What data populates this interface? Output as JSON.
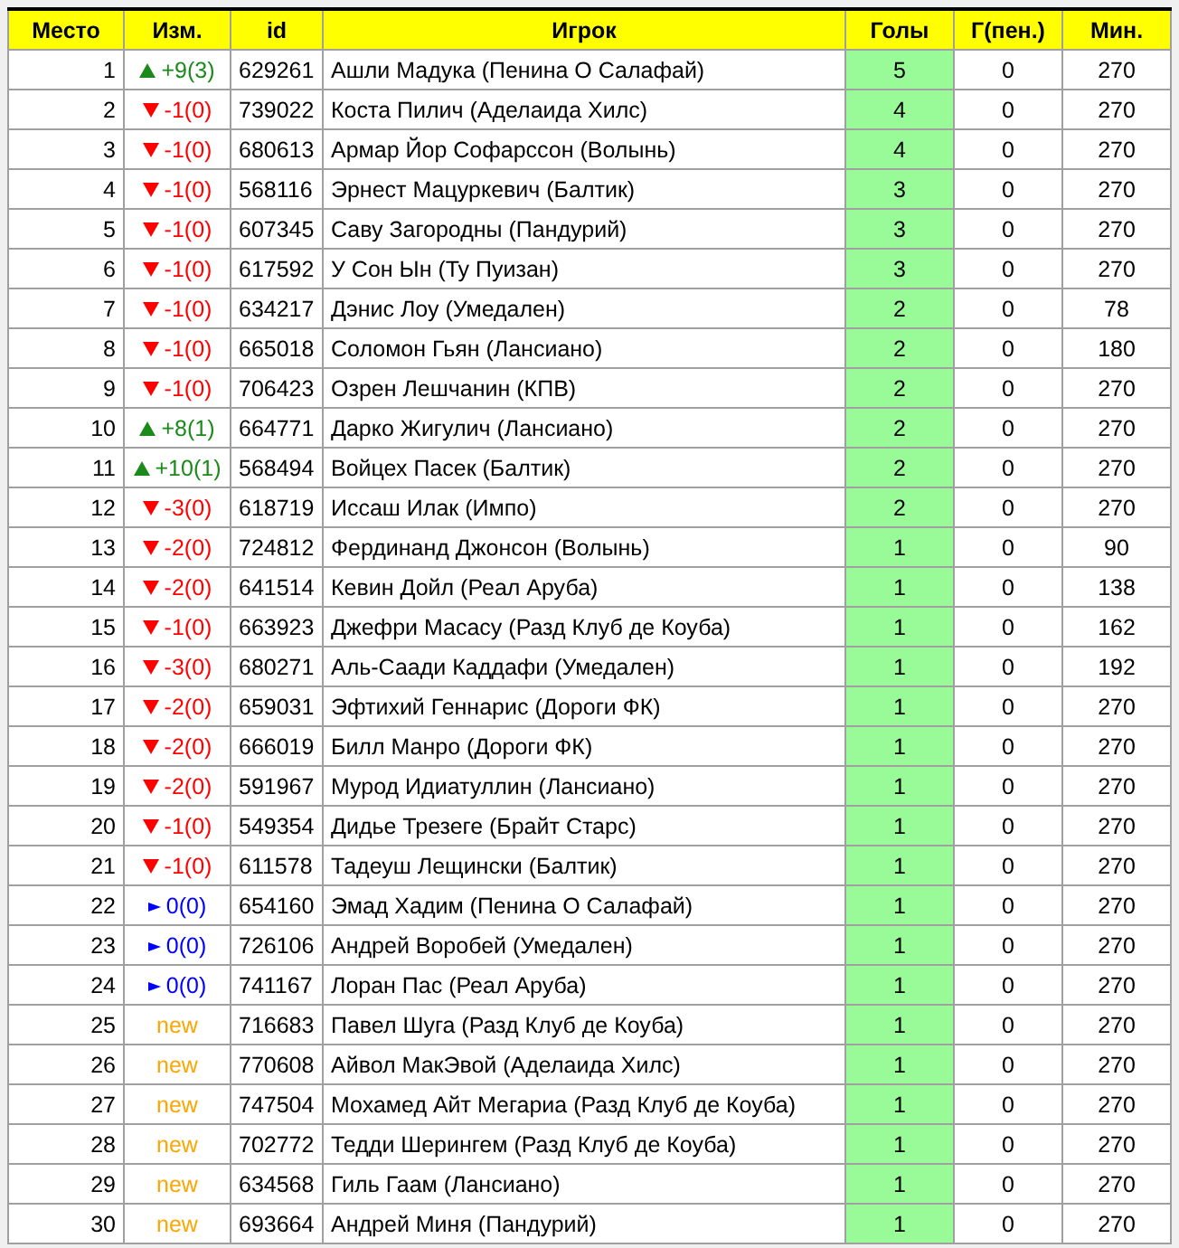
{
  "table": {
    "columns": [
      {
        "label": "Место",
        "sorted": false
      },
      {
        "label": "Изм.",
        "sorted": false
      },
      {
        "label": "id",
        "sorted": false
      },
      {
        "label": "Игрок",
        "sorted": false
      },
      {
        "label": "Голы",
        "sorted": true
      },
      {
        "label": "Г(пен.)",
        "sorted": false
      },
      {
        "label": "Мин.",
        "sorted": false
      }
    ],
    "rows": [
      {
        "place": "1",
        "change": {
          "kind": "up",
          "text": "+9(3)"
        },
        "id": "629261",
        "player": "Ашли Мадука (Пенина О Салафай)",
        "goals": "5",
        "pen": "0",
        "min": "270"
      },
      {
        "place": "2",
        "change": {
          "kind": "down",
          "text": "-1(0)"
        },
        "id": "739022",
        "player": "Коста Пилич (Аделаида Хилс)",
        "goals": "4",
        "pen": "0",
        "min": "270"
      },
      {
        "place": "3",
        "change": {
          "kind": "down",
          "text": "-1(0)"
        },
        "id": "680613",
        "player": "Армар Йор Софарссон (Волынь)",
        "goals": "4",
        "pen": "0",
        "min": "270"
      },
      {
        "place": "4",
        "change": {
          "kind": "down",
          "text": "-1(0)"
        },
        "id": "568116",
        "player": "Эрнест Мацуркевич (Балтик)",
        "goals": "3",
        "pen": "0",
        "min": "270"
      },
      {
        "place": "5",
        "change": {
          "kind": "down",
          "text": "-1(0)"
        },
        "id": "607345",
        "player": "Саву Загородны (Пандурий)",
        "goals": "3",
        "pen": "0",
        "min": "270"
      },
      {
        "place": "6",
        "change": {
          "kind": "down",
          "text": "-1(0)"
        },
        "id": "617592",
        "player": "У Сон Ын (Ту Пуизан)",
        "goals": "3",
        "pen": "0",
        "min": "270"
      },
      {
        "place": "7",
        "change": {
          "kind": "down",
          "text": "-1(0)"
        },
        "id": "634217",
        "player": "Дэнис Лоу (Умедален)",
        "goals": "2",
        "pen": "0",
        "min": "78"
      },
      {
        "place": "8",
        "change": {
          "kind": "down",
          "text": "-1(0)"
        },
        "id": "665018",
        "player": "Соломон Гьян (Лансиано)",
        "goals": "2",
        "pen": "0",
        "min": "180"
      },
      {
        "place": "9",
        "change": {
          "kind": "down",
          "text": "-1(0)"
        },
        "id": "706423",
        "player": "Озрен Лешчанин (КПВ)",
        "goals": "2",
        "pen": "0",
        "min": "270"
      },
      {
        "place": "10",
        "change": {
          "kind": "up",
          "text": "+8(1)"
        },
        "id": "664771",
        "player": "Дарко Жигулич (Лансиано)",
        "goals": "2",
        "pen": "0",
        "min": "270"
      },
      {
        "place": "11",
        "change": {
          "kind": "up",
          "text": "+10(1)"
        },
        "id": "568494",
        "player": "Войцех Пасек (Балтик)",
        "goals": "2",
        "pen": "0",
        "min": "270"
      },
      {
        "place": "12",
        "change": {
          "kind": "down",
          "text": "-3(0)"
        },
        "id": "618719",
        "player": "Иссаш Илак (Импо)",
        "goals": "2",
        "pen": "0",
        "min": "270"
      },
      {
        "place": "13",
        "change": {
          "kind": "down",
          "text": "-2(0)"
        },
        "id": "724812",
        "player": "Фердинанд Джонсон (Волынь)",
        "goals": "1",
        "pen": "0",
        "min": "90"
      },
      {
        "place": "14",
        "change": {
          "kind": "down",
          "text": "-2(0)"
        },
        "id": "641514",
        "player": "Кевин Дойл (Реал Аруба)",
        "goals": "1",
        "pen": "0",
        "min": "138"
      },
      {
        "place": "15",
        "change": {
          "kind": "down",
          "text": "-1(0)"
        },
        "id": "663923",
        "player": "Джефри Масасу (Разд Клуб де Коуба)",
        "goals": "1",
        "pen": "0",
        "min": "162"
      },
      {
        "place": "16",
        "change": {
          "kind": "down",
          "text": "-3(0)"
        },
        "id": "680271",
        "player": "Аль-Саади Каддафи (Умедален)",
        "goals": "1",
        "pen": "0",
        "min": "192"
      },
      {
        "place": "17",
        "change": {
          "kind": "down",
          "text": "-2(0)"
        },
        "id": "659031",
        "player": "Эфтихий Геннарис (Дороги ФК)",
        "goals": "1",
        "pen": "0",
        "min": "270"
      },
      {
        "place": "18",
        "change": {
          "kind": "down",
          "text": "-2(0)"
        },
        "id": "666019",
        "player": "Билл Манро (Дороги ФК)",
        "goals": "1",
        "pen": "0",
        "min": "270"
      },
      {
        "place": "19",
        "change": {
          "kind": "down",
          "text": "-2(0)"
        },
        "id": "591967",
        "player": "Мурод Идиатуллин (Лансиано)",
        "goals": "1",
        "pen": "0",
        "min": "270"
      },
      {
        "place": "20",
        "change": {
          "kind": "down",
          "text": "-1(0)"
        },
        "id": "549354",
        "player": "Дидье Трезеге (Брайт Старс)",
        "goals": "1",
        "pen": "0",
        "min": "270"
      },
      {
        "place": "21",
        "change": {
          "kind": "down",
          "text": "-1(0)"
        },
        "id": "611578",
        "player": "Тадеуш Лещински (Балтик)",
        "goals": "1",
        "pen": "0",
        "min": "270"
      },
      {
        "place": "22",
        "change": {
          "kind": "same",
          "text": "0(0)"
        },
        "id": "654160",
        "player": "Эмад Хадим (Пенина О Салафай)",
        "goals": "1",
        "pen": "0",
        "min": "270"
      },
      {
        "place": "23",
        "change": {
          "kind": "same",
          "text": "0(0)"
        },
        "id": "726106",
        "player": "Андрей Воробей (Умедален)",
        "goals": "1",
        "pen": "0",
        "min": "270"
      },
      {
        "place": "24",
        "change": {
          "kind": "same",
          "text": "0(0)"
        },
        "id": "741167",
        "player": "Лоран Пас (Реал Аруба)",
        "goals": "1",
        "pen": "0",
        "min": "270"
      },
      {
        "place": "25",
        "change": {
          "kind": "new",
          "text": "new"
        },
        "id": "716683",
        "player": "Павел Шуга (Разд Клуб де Коуба)",
        "goals": "1",
        "pen": "0",
        "min": "270"
      },
      {
        "place": "26",
        "change": {
          "kind": "new",
          "text": "new"
        },
        "id": "770608",
        "player": "Айвол МакЭвой (Аделаида Хилс)",
        "goals": "1",
        "pen": "0",
        "min": "270"
      },
      {
        "place": "27",
        "change": {
          "kind": "new",
          "text": "new"
        },
        "id": "747504",
        "player": "Мохамед Айт Мегариа (Разд Клуб де Коуба)",
        "goals": "1",
        "pen": "0",
        "min": "270"
      },
      {
        "place": "28",
        "change": {
          "kind": "new",
          "text": "new"
        },
        "id": "702772",
        "player": "Тедди Шерингем (Разд Клуб де Коуба)",
        "goals": "1",
        "pen": "0",
        "min": "270"
      },
      {
        "place": "29",
        "change": {
          "kind": "new",
          "text": "new"
        },
        "id": "634568",
        "player": "Гиль Гаам (Лансиано)",
        "goals": "1",
        "pen": "0",
        "min": "270"
      },
      {
        "place": "30",
        "change": {
          "kind": "new",
          "text": "new"
        },
        "id": "693664",
        "player": "Андрей Миня (Пандурий)",
        "goals": "1",
        "pen": "0",
        "min": "270"
      }
    ]
  }
}
